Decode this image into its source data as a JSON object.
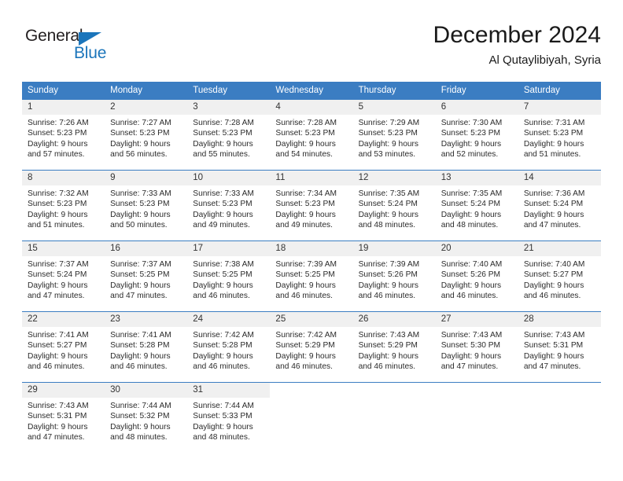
{
  "brand": {
    "name_part1": "General",
    "name_part2": "Blue",
    "triangle_color": "#1b75bb"
  },
  "header": {
    "title": "December 2024",
    "subtitle": "Al Qutaylibiyah, Syria"
  },
  "theme": {
    "header_bg": "#3b7dc2",
    "daynum_bg": "#f0f0f0",
    "grid_line": "#3b7dc2"
  },
  "weekday_headers": [
    "Sunday",
    "Monday",
    "Tuesday",
    "Wednesday",
    "Thursday",
    "Friday",
    "Saturday"
  ],
  "weeks": [
    [
      {
        "day": "1",
        "sunrise": "Sunrise: 7:26 AM",
        "sunset": "Sunset: 5:23 PM",
        "daylight1": "Daylight: 9 hours",
        "daylight2": "and 57 minutes."
      },
      {
        "day": "2",
        "sunrise": "Sunrise: 7:27 AM",
        "sunset": "Sunset: 5:23 PM",
        "daylight1": "Daylight: 9 hours",
        "daylight2": "and 56 minutes."
      },
      {
        "day": "3",
        "sunrise": "Sunrise: 7:28 AM",
        "sunset": "Sunset: 5:23 PM",
        "daylight1": "Daylight: 9 hours",
        "daylight2": "and 55 minutes."
      },
      {
        "day": "4",
        "sunrise": "Sunrise: 7:28 AM",
        "sunset": "Sunset: 5:23 PM",
        "daylight1": "Daylight: 9 hours",
        "daylight2": "and 54 minutes."
      },
      {
        "day": "5",
        "sunrise": "Sunrise: 7:29 AM",
        "sunset": "Sunset: 5:23 PM",
        "daylight1": "Daylight: 9 hours",
        "daylight2": "and 53 minutes."
      },
      {
        "day": "6",
        "sunrise": "Sunrise: 7:30 AM",
        "sunset": "Sunset: 5:23 PM",
        "daylight1": "Daylight: 9 hours",
        "daylight2": "and 52 minutes."
      },
      {
        "day": "7",
        "sunrise": "Sunrise: 7:31 AM",
        "sunset": "Sunset: 5:23 PM",
        "daylight1": "Daylight: 9 hours",
        "daylight2": "and 51 minutes."
      }
    ],
    [
      {
        "day": "8",
        "sunrise": "Sunrise: 7:32 AM",
        "sunset": "Sunset: 5:23 PM",
        "daylight1": "Daylight: 9 hours",
        "daylight2": "and 51 minutes."
      },
      {
        "day": "9",
        "sunrise": "Sunrise: 7:33 AM",
        "sunset": "Sunset: 5:23 PM",
        "daylight1": "Daylight: 9 hours",
        "daylight2": "and 50 minutes."
      },
      {
        "day": "10",
        "sunrise": "Sunrise: 7:33 AM",
        "sunset": "Sunset: 5:23 PM",
        "daylight1": "Daylight: 9 hours",
        "daylight2": "and 49 minutes."
      },
      {
        "day": "11",
        "sunrise": "Sunrise: 7:34 AM",
        "sunset": "Sunset: 5:23 PM",
        "daylight1": "Daylight: 9 hours",
        "daylight2": "and 49 minutes."
      },
      {
        "day": "12",
        "sunrise": "Sunrise: 7:35 AM",
        "sunset": "Sunset: 5:24 PM",
        "daylight1": "Daylight: 9 hours",
        "daylight2": "and 48 minutes."
      },
      {
        "day": "13",
        "sunrise": "Sunrise: 7:35 AM",
        "sunset": "Sunset: 5:24 PM",
        "daylight1": "Daylight: 9 hours",
        "daylight2": "and 48 minutes."
      },
      {
        "day": "14",
        "sunrise": "Sunrise: 7:36 AM",
        "sunset": "Sunset: 5:24 PM",
        "daylight1": "Daylight: 9 hours",
        "daylight2": "and 47 minutes."
      }
    ],
    [
      {
        "day": "15",
        "sunrise": "Sunrise: 7:37 AM",
        "sunset": "Sunset: 5:24 PM",
        "daylight1": "Daylight: 9 hours",
        "daylight2": "and 47 minutes."
      },
      {
        "day": "16",
        "sunrise": "Sunrise: 7:37 AM",
        "sunset": "Sunset: 5:25 PM",
        "daylight1": "Daylight: 9 hours",
        "daylight2": "and 47 minutes."
      },
      {
        "day": "17",
        "sunrise": "Sunrise: 7:38 AM",
        "sunset": "Sunset: 5:25 PM",
        "daylight1": "Daylight: 9 hours",
        "daylight2": "and 46 minutes."
      },
      {
        "day": "18",
        "sunrise": "Sunrise: 7:39 AM",
        "sunset": "Sunset: 5:25 PM",
        "daylight1": "Daylight: 9 hours",
        "daylight2": "and 46 minutes."
      },
      {
        "day": "19",
        "sunrise": "Sunrise: 7:39 AM",
        "sunset": "Sunset: 5:26 PM",
        "daylight1": "Daylight: 9 hours",
        "daylight2": "and 46 minutes."
      },
      {
        "day": "20",
        "sunrise": "Sunrise: 7:40 AM",
        "sunset": "Sunset: 5:26 PM",
        "daylight1": "Daylight: 9 hours",
        "daylight2": "and 46 minutes."
      },
      {
        "day": "21",
        "sunrise": "Sunrise: 7:40 AM",
        "sunset": "Sunset: 5:27 PM",
        "daylight1": "Daylight: 9 hours",
        "daylight2": "and 46 minutes."
      }
    ],
    [
      {
        "day": "22",
        "sunrise": "Sunrise: 7:41 AM",
        "sunset": "Sunset: 5:27 PM",
        "daylight1": "Daylight: 9 hours",
        "daylight2": "and 46 minutes."
      },
      {
        "day": "23",
        "sunrise": "Sunrise: 7:41 AM",
        "sunset": "Sunset: 5:28 PM",
        "daylight1": "Daylight: 9 hours",
        "daylight2": "and 46 minutes."
      },
      {
        "day": "24",
        "sunrise": "Sunrise: 7:42 AM",
        "sunset": "Sunset: 5:28 PM",
        "daylight1": "Daylight: 9 hours",
        "daylight2": "and 46 minutes."
      },
      {
        "day": "25",
        "sunrise": "Sunrise: 7:42 AM",
        "sunset": "Sunset: 5:29 PM",
        "daylight1": "Daylight: 9 hours",
        "daylight2": "and 46 minutes."
      },
      {
        "day": "26",
        "sunrise": "Sunrise: 7:43 AM",
        "sunset": "Sunset: 5:29 PM",
        "daylight1": "Daylight: 9 hours",
        "daylight2": "and 46 minutes."
      },
      {
        "day": "27",
        "sunrise": "Sunrise: 7:43 AM",
        "sunset": "Sunset: 5:30 PM",
        "daylight1": "Daylight: 9 hours",
        "daylight2": "and 47 minutes."
      },
      {
        "day": "28",
        "sunrise": "Sunrise: 7:43 AM",
        "sunset": "Sunset: 5:31 PM",
        "daylight1": "Daylight: 9 hours",
        "daylight2": "and 47 minutes."
      }
    ],
    [
      {
        "day": "29",
        "sunrise": "Sunrise: 7:43 AM",
        "sunset": "Sunset: 5:31 PM",
        "daylight1": "Daylight: 9 hours",
        "daylight2": "and 47 minutes."
      },
      {
        "day": "30",
        "sunrise": "Sunrise: 7:44 AM",
        "sunset": "Sunset: 5:32 PM",
        "daylight1": "Daylight: 9 hours",
        "daylight2": "and 48 minutes."
      },
      {
        "day": "31",
        "sunrise": "Sunrise: 7:44 AM",
        "sunset": "Sunset: 5:33 PM",
        "daylight1": "Daylight: 9 hours",
        "daylight2": "and 48 minutes."
      },
      {
        "day": "",
        "sunrise": "",
        "sunset": "",
        "daylight1": "",
        "daylight2": ""
      },
      {
        "day": "",
        "sunrise": "",
        "sunset": "",
        "daylight1": "",
        "daylight2": ""
      },
      {
        "day": "",
        "sunrise": "",
        "sunset": "",
        "daylight1": "",
        "daylight2": ""
      },
      {
        "day": "",
        "sunrise": "",
        "sunset": "",
        "daylight1": "",
        "daylight2": ""
      }
    ]
  ]
}
